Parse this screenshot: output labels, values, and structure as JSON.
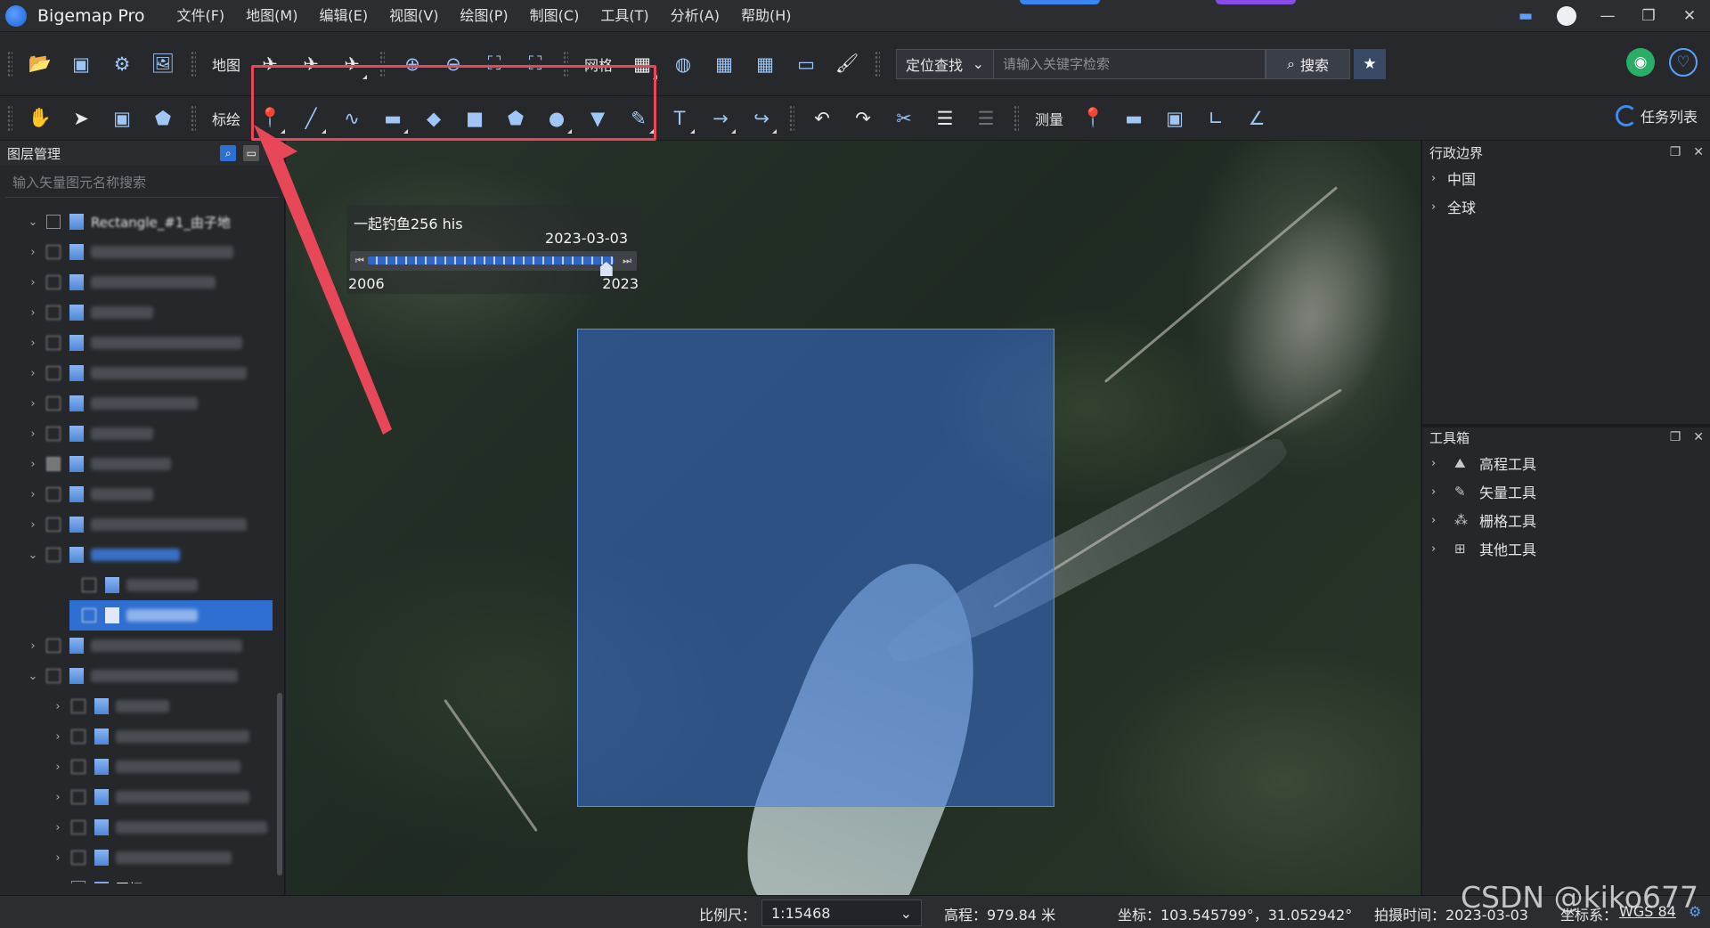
{
  "app": {
    "title": "Bigemap Pro"
  },
  "menu": [
    "文件(F)",
    "地图(M)",
    "编辑(E)",
    "视图(V)",
    "绘图(P)",
    "制图(C)",
    "工具(T)",
    "分析(A)",
    "帮助(H)"
  ],
  "toolbar1": {
    "map_label": "地图",
    "grid_label": "网格",
    "locate_label": "定位查找",
    "search_placeholder": "请输入关键字检索",
    "search_button": "搜索"
  },
  "toolbar2": {
    "draw_label": "标绘",
    "measure_label": "测量",
    "task_list": "任务列表"
  },
  "left_panel": {
    "title": "图层管理",
    "search_placeholder": "输入矢量图元名称搜索",
    "top_row_label": "Rectangle_#1_由子地",
    "bottom_row_label": "图框"
  },
  "timeline": {
    "title": "一起钓鱼256 his",
    "current_date": "2023-03-03",
    "start_year": "2006",
    "end_year": "2023",
    "position": 0.97
  },
  "right_panel": {
    "admin_title": "行政边界",
    "admin_items": [
      "中国",
      "全球"
    ],
    "toolbox_title": "工具箱",
    "toolbox_items": [
      "高程工具",
      "矢量工具",
      "栅格工具",
      "其他工具"
    ]
  },
  "statusbar": {
    "scale_label": "比例尺：",
    "scale_value": "1:15468",
    "elevation": "高程：979.84 米",
    "coords": "坐标：103.545799°，31.052942°",
    "capture_time": "拍摄时间：2023-03-03",
    "crs_label": "坐标系：",
    "crs_value": "WGS 84"
  },
  "watermark": "CSDN @kiko677",
  "colors": {
    "accent": "#2f6fd1",
    "highlight": "#e8475a",
    "selection_fill": "#3c78e6"
  }
}
